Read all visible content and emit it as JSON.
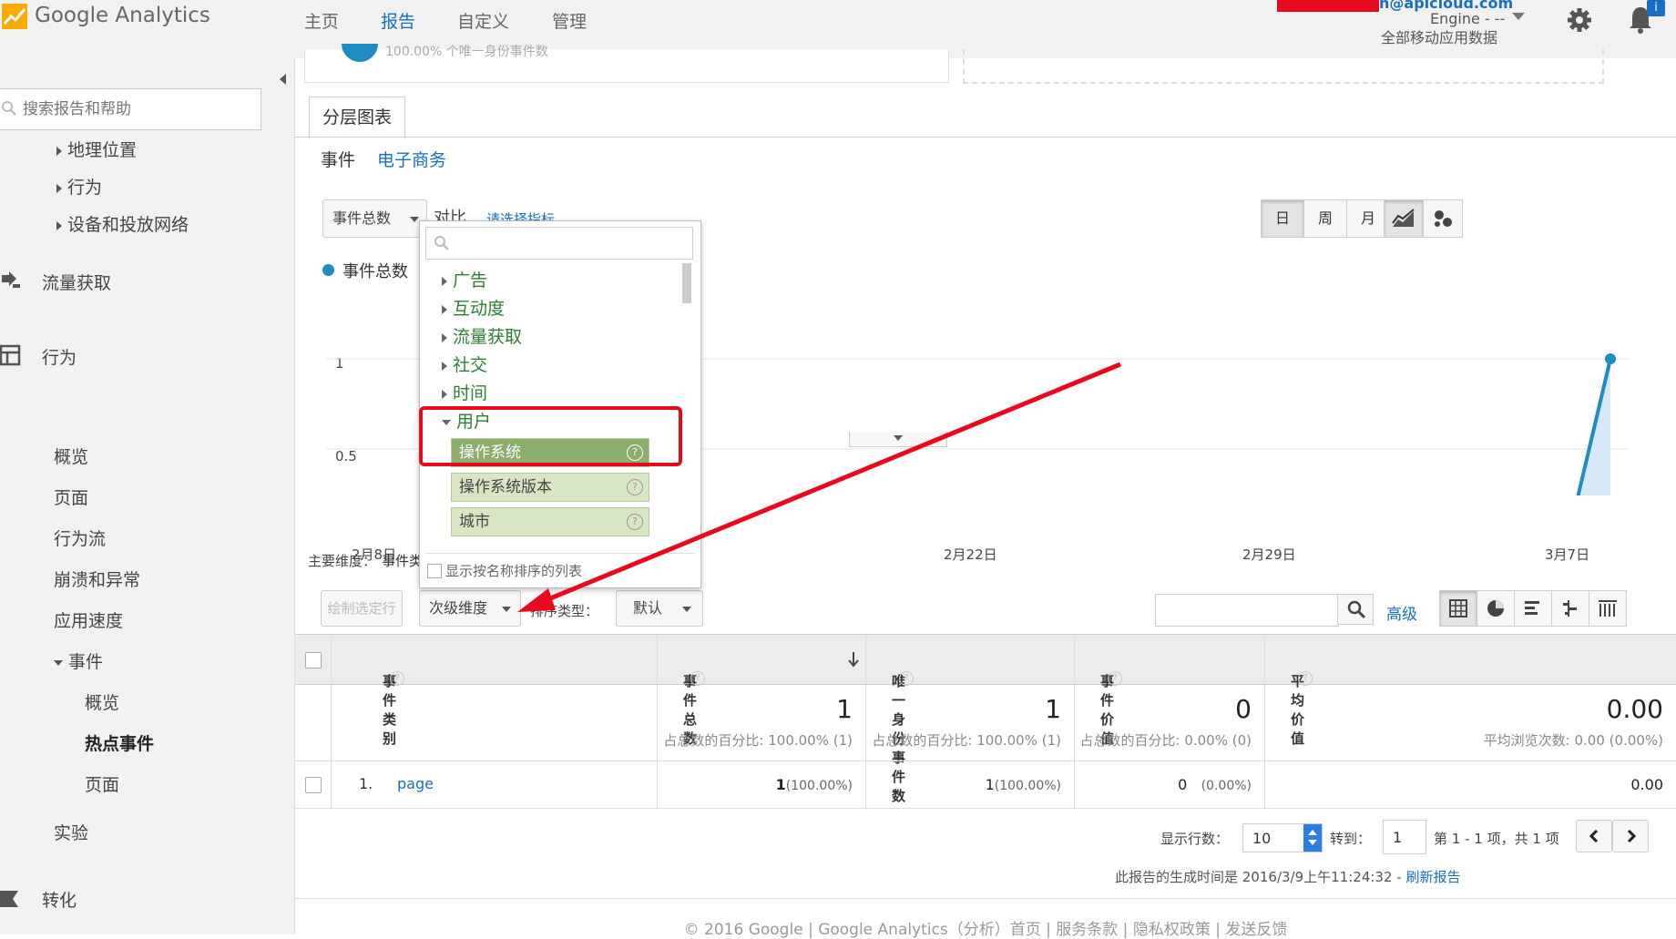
{
  "app": {
    "brand": "Google Analytics",
    "nav": [
      "主页",
      "报告",
      "自定义",
      "管理"
    ],
    "nav_active": "报告",
    "account_email": "n@apicloud.com",
    "account_engine": "Engine - --",
    "account_scope": "全部移动应用数据",
    "badge": "i",
    "accent": "#1a6ec2",
    "logo_colors": [
      "#f9ab00",
      "#e37400"
    ]
  },
  "sidebar": {
    "search_placeholder": "搜索报告和帮助",
    "items": [
      {
        "label": "地理位置",
        "icon": "caret-right-icon"
      },
      {
        "label": "行为",
        "icon": "caret-right-icon"
      },
      {
        "label": "设备和投放网络",
        "icon": "caret-right-icon"
      },
      {
        "label": "流量获取",
        "icon": "acquisition-icon"
      },
      {
        "label": "行为",
        "icon": "behavior-icon"
      },
      {
        "label": "概览"
      },
      {
        "label": "页面"
      },
      {
        "label": "行为流"
      },
      {
        "label": "崩溃和异常"
      },
      {
        "label": "应用速度"
      },
      {
        "label": "事件",
        "icon": "caret-down-icon"
      },
      {
        "label": "概览"
      },
      {
        "label": "热点事件"
      },
      {
        "label": "页面"
      },
      {
        "label": "实验"
      },
      {
        "label": "转化",
        "icon": "conversion-icon"
      }
    ]
  },
  "main": {
    "top_card_text": "100.00% 个唯一身份事件数",
    "tab": "分层图表",
    "subtabs": [
      "事件",
      "电子商务"
    ],
    "metric_select": "事件总数",
    "compare_label": "对比",
    "compare_pick": "请选择指标",
    "granularity": [
      "日",
      "周",
      "月"
    ],
    "granularity_active": "日",
    "legend": "事件总数",
    "primary_dim_label": "主要维度：",
    "primary_dim_value": "事件类别"
  },
  "chart_data": {
    "type": "line",
    "series": [
      {
        "name": "事件总数",
        "values": [
          0,
          0,
          0,
          0,
          0,
          0,
          0,
          0,
          0,
          0,
          0,
          0,
          0,
          0,
          0,
          0,
          0,
          0,
          0,
          0,
          0,
          0,
          0,
          0,
          0,
          0,
          0,
          0,
          0,
          0,
          1
        ]
      }
    ],
    "x_ticks": [
      "2月8日",
      "2月22日",
      "2月29日",
      "3月7日"
    ],
    "y_ticks": [
      "1",
      "0.5"
    ],
    "ylim": [
      0,
      1
    ],
    "color": "#1e8bc3"
  },
  "dropdown": {
    "categories": [
      {
        "label": "广告",
        "expanded": false
      },
      {
        "label": "互动度",
        "expanded": false
      },
      {
        "label": "流量获取",
        "expanded": false
      },
      {
        "label": "社交",
        "expanded": false
      },
      {
        "label": "时间",
        "expanded": false
      },
      {
        "label": "用户",
        "expanded": true
      }
    ],
    "options": [
      {
        "label": "操作系统",
        "selected": true
      },
      {
        "label": "操作系统版本",
        "selected": false
      },
      {
        "label": "城市",
        "selected": false
      }
    ],
    "sort_by_name": "显示按名称排序的列表"
  },
  "toolbar": {
    "plot_rows": "绘制选定行",
    "secondary_dim": "次级维度",
    "sort_type_label": "排序类型：",
    "sort_type": "默认",
    "advanced": "高级"
  },
  "table": {
    "headers": [
      "事件类别",
      "事件总数",
      "唯一身份事件数",
      "事件价值",
      "平均价值"
    ],
    "totals": [
      {
        "value": "1",
        "sub": "占总数的百分比: 100.00% (1)"
      },
      {
        "value": "1",
        "sub": "占总数的百分比: 100.00% (1)"
      },
      {
        "value": "0",
        "sub": "占总数的百分比: 0.00% (0)"
      },
      {
        "value": "0.00",
        "sub": "平均浏览次数: 0.00 (0.00%)"
      }
    ],
    "rows": [
      {
        "index": "1.",
        "category": "page",
        "c1": "1",
        "c1p": "(100.00%)",
        "c2": "1",
        "c2p": "(100.00%)",
        "c3": "0",
        "c3p": "(0.00%)",
        "c4": "0.00"
      }
    ]
  },
  "pager": {
    "rows_label": "显示行数：",
    "rows_value": "10",
    "goto_label": "转到：",
    "goto_value": "1",
    "range": "第 1 - 1 项，共 1 项",
    "generated": "此报告的生成时间是 2016/3/9上午11:24:32 -",
    "refresh": "刷新报告"
  },
  "footer": "© 2016 Google | Google Analytics（分析）首页 | 服务条款 | 隐私权政策 | 发送反馈"
}
